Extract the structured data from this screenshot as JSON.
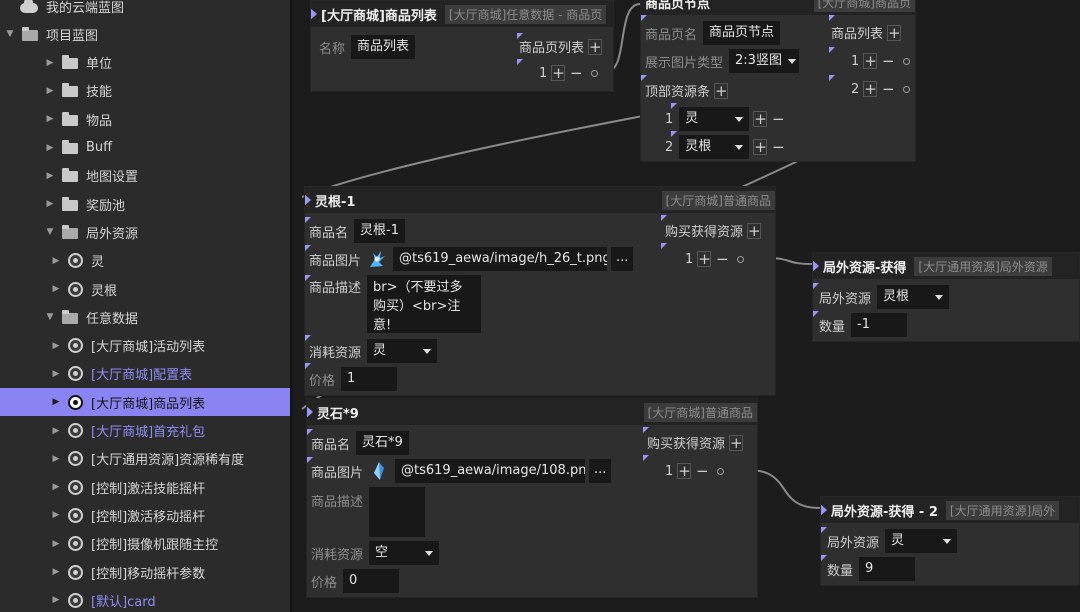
{
  "sidebar": {
    "items": [
      {
        "label": "我的云端蓝图",
        "icon": "cloud-icon",
        "arrow": "",
        "blue": false
      },
      {
        "label": "项目蓝图",
        "icon": "folder-open-icon",
        "arrow": "▼",
        "blue": false
      },
      {
        "label": "单位",
        "icon": "folder-icon",
        "arrow": "▶",
        "blue": false
      },
      {
        "label": "技能",
        "icon": "folder-icon",
        "arrow": "▶",
        "blue": false
      },
      {
        "label": "物品",
        "icon": "folder-icon",
        "arrow": "▶",
        "blue": false
      },
      {
        "label": "Buff",
        "icon": "folder-icon",
        "arrow": "▶",
        "blue": false
      },
      {
        "label": "地图设置",
        "icon": "folder-icon",
        "arrow": "▶",
        "blue": false
      },
      {
        "label": "奖励池",
        "icon": "folder-icon",
        "arrow": "▶",
        "blue": false
      },
      {
        "label": "局外资源",
        "icon": "folder-open-icon",
        "arrow": "▼",
        "blue": false
      },
      {
        "label": "灵",
        "icon": "resource-icon",
        "arrow": "▶",
        "blue": false
      },
      {
        "label": "灵根",
        "icon": "resource-icon",
        "arrow": "▶",
        "blue": false
      },
      {
        "label": "任意数据",
        "icon": "folder-open-icon",
        "arrow": "▼",
        "blue": false
      },
      {
        "label": "[大厅商城]活动列表",
        "icon": "resource-icon",
        "arrow": "▶",
        "blue": false
      },
      {
        "label": "[大厅商城]配置表",
        "icon": "resource-icon",
        "arrow": "▶",
        "blue": true
      },
      {
        "label": "[大厅商城]商品列表",
        "icon": "resource-icon",
        "arrow": "▶",
        "blue": false
      },
      {
        "label": "[大厅商城]首充礼包",
        "icon": "resource-icon",
        "arrow": "▶",
        "blue": true
      },
      {
        "label": "[大厅通用资源]资源稀有度",
        "icon": "resource-icon",
        "arrow": "▶",
        "blue": false
      },
      {
        "label": "[控制]激活技能摇杆",
        "icon": "resource-icon",
        "arrow": "▶",
        "blue": false
      },
      {
        "label": "[控制]激活移动摇杆",
        "icon": "resource-icon",
        "arrow": "▶",
        "blue": false
      },
      {
        "label": "[控制]摄像机跟随主控",
        "icon": "resource-icon",
        "arrow": "▶",
        "blue": false
      },
      {
        "label": "[控制]移动摇杆参数",
        "icon": "resource-icon",
        "arrow": "▶",
        "blue": false
      },
      {
        "label": "[默认]card",
        "icon": "resource-icon",
        "arrow": "▶",
        "blue": true
      }
    ],
    "selected_index": 14
  },
  "nodes": {
    "list": {
      "title": "[大厅商城]商品列表",
      "subtitle": "[大厅商城]任意数据 - 商品页",
      "name_label": "名称",
      "name_value": "商品列表",
      "pages_label": "商品页列表",
      "row1": "1"
    },
    "page": {
      "title": "商品页节点",
      "subtitle": "[大厅商城]商品页",
      "name_label": "商品页名",
      "name_value": "商品页节点",
      "img_type_label": "展示图片类型",
      "img_type_value": "2:3竖图",
      "goods_label": "商品列表",
      "goods_row1": "1",
      "goods_row2": "2",
      "top_label": "顶部资源条",
      "top_row1_idx": "1",
      "top_row1_val": "灵",
      "top_row2_idx": "2",
      "top_row2_val": "灵根"
    },
    "goods1": {
      "title": "灵根-1",
      "subtitle": "[大厅商城]普通商品",
      "name_label": "商品名",
      "name_value": "灵根-1",
      "img_label": "商品图片",
      "img_path": "@ts619_aewa/image/h_26_t.png",
      "more": "...",
      "desc_label": "商品描述",
      "desc_value": "br>（不要过多购买）<br>注意!",
      "cost_label": "消耗资源",
      "cost_value": "灵",
      "price_label": "价格",
      "price_value": "1",
      "gain_label": "购买获得资源",
      "gain_row1": "1"
    },
    "goods2": {
      "title": "灵石*9",
      "subtitle": "[大厅商城]普通商品",
      "name_label": "商品名",
      "name_value": "灵石*9",
      "img_label": "商品图片",
      "img_path": "@ts619_aewa/image/108.png",
      "more": "...",
      "desc_label": "商品描述",
      "desc_value": "",
      "cost_label": "消耗资源",
      "cost_value": "空",
      "price_label": "价格",
      "price_value": "0",
      "gain_label": "购买获得资源",
      "gain_row1": "1"
    },
    "res1": {
      "title": "局外资源-获得",
      "subtitle": "[大厅通用资源]局外资源",
      "res_label": "局外资源",
      "res_value": "灵根",
      "qty_label": "数量",
      "qty_value": "-1"
    },
    "res2": {
      "title": "局外资源-获得 - 2",
      "subtitle": "[大厅通用资源]局外",
      "res_label": "局外资源",
      "res_value": "灵",
      "qty_label": "数量",
      "qty_value": "9"
    }
  },
  "colors": {
    "accent": "#8a84f2",
    "pin": "#9b96f6",
    "link_blue": "#8f8cf5"
  }
}
